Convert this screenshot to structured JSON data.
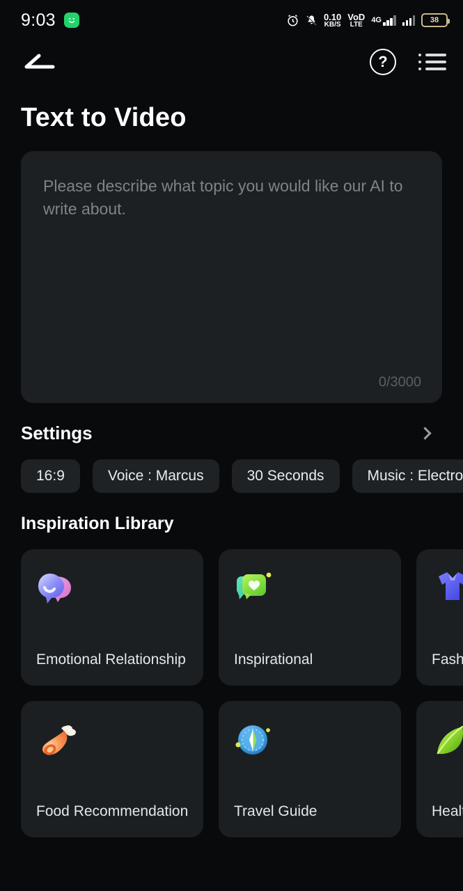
{
  "statusbar": {
    "time": "9:03",
    "app_icon": "smiley-app-icon",
    "alarm_icon": "alarm-clock-icon",
    "silent_icon": "bell-muted-icon",
    "net_speed_value": "0.10",
    "net_speed_unit": "KB/S",
    "volte_line1": "VoD",
    "volte_line2": "LTE",
    "network_type": "4G",
    "battery_level": "38"
  },
  "navbar": {
    "back_icon": "back-arrow-icon",
    "help_icon": "help-question-icon",
    "help_label": "?",
    "menu_icon": "list-menu-icon"
  },
  "header": {
    "title": "Text to Video"
  },
  "prompt": {
    "placeholder": "Please describe what topic you would like our AI to write about.",
    "value": "",
    "counter": "0/3000",
    "max_chars": 3000
  },
  "settings": {
    "label": "Settings",
    "chevron_icon": "chevron-right-icon",
    "chips": [
      {
        "label": "16:9",
        "name": "chip-aspect-ratio"
      },
      {
        "label": "Voice : Marcus",
        "name": "chip-voice"
      },
      {
        "label": "30 Seconds",
        "name": "chip-duration"
      },
      {
        "label": "Music : Electronic",
        "name": "chip-music"
      }
    ]
  },
  "inspiration": {
    "title": "Inspiration Library",
    "cards": [
      {
        "label": "Emotional Relationship",
        "icon": "chat-bubble-smile-icon",
        "name": "card-emotional-relationship"
      },
      {
        "label": "Inspirational",
        "icon": "chat-bubble-heart-icon",
        "name": "card-inspirational"
      },
      {
        "label": "Fashion",
        "icon": "clothing-icon",
        "name": "card-fashion"
      },
      {
        "label": "Food Recommendation",
        "icon": "meat-on-bone-icon",
        "name": "card-food-recommendation"
      },
      {
        "label": "Travel Guide",
        "icon": "compass-icon",
        "name": "card-travel-guide"
      },
      {
        "label": "Health",
        "icon": "leaf-icon",
        "name": "card-health"
      }
    ]
  },
  "colors": {
    "background": "#080a0c",
    "surface": "#1b1f22",
    "prompt_surface": "#1c2023",
    "text_primary": "#ffffff",
    "text_muted": "#7d8489",
    "app_icon_green": "#22d36b",
    "battery_gold": "#c8b98a"
  }
}
